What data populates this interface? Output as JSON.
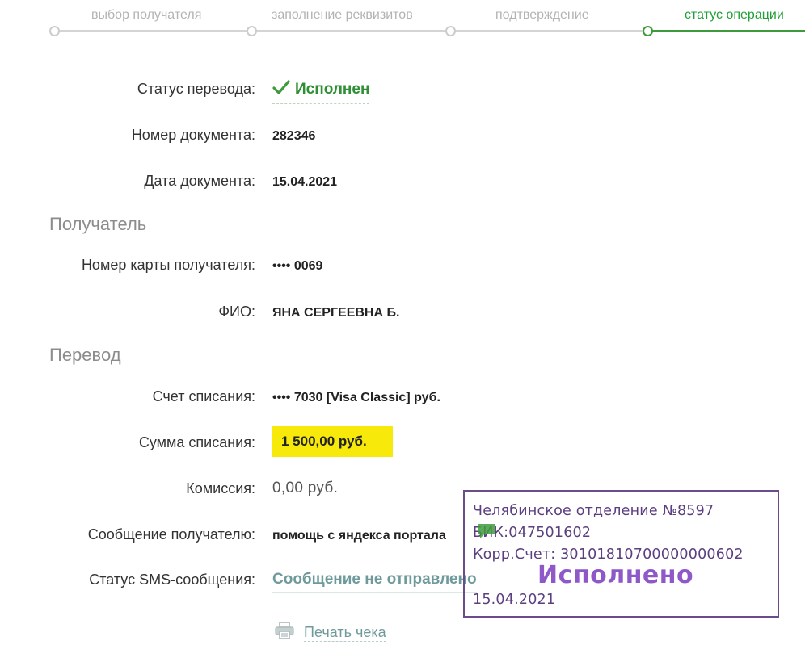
{
  "steps": [
    {
      "label": "выбор получателя",
      "active": false
    },
    {
      "label": "заполнение реквизитов",
      "active": false
    },
    {
      "label": "подтверждение",
      "active": false
    },
    {
      "label": "статус операции",
      "active": true
    }
  ],
  "details": {
    "status_label": "Статус перевода:",
    "status_value": "Исполнен",
    "doc_number_label": "Номер документа:",
    "doc_number_value": "282346",
    "doc_date_label": "Дата документа:",
    "doc_date_value": "15.04.2021"
  },
  "recipient": {
    "section_title": "Получатель",
    "card_label": "Номер карты получателя:",
    "card_value": "•••• 0069",
    "name_label": "ФИО:",
    "name_value": "ЯНА СЕРГЕЕВНА Б."
  },
  "transfer": {
    "section_title": "Перевод",
    "account_label": "Счет списания:",
    "account_value": "•••• 7030  [Visa Classic]  руб.",
    "amount_label": "Сумма списания:",
    "amount_value": "1 500,00  руб.",
    "fee_label": "Комиссия:",
    "fee_value": "0,00 руб.",
    "message_label": "Сообщение получателю:",
    "message_value": "помощь с яндекса портала",
    "sms_label": "Статус SMS-сообщения:",
    "sms_value": "Сообщение не отправлено"
  },
  "print": {
    "label": "Печать чека"
  },
  "stamp": {
    "branch": "Челябинское отделение №8597",
    "bik": "БИК:047501602",
    "corr": "Корр.Счет: 30101810700000000602",
    "status": "Исполнено",
    "date": "15.04.2021"
  },
  "colors": {
    "accent_green": "#21a038",
    "amount_highlight": "#f7ea0a",
    "stamp_purple": "#6a4c8a",
    "link_teal": "#6f9a9b"
  },
  "icons": {
    "status": "check-icon",
    "sms": "message-bubble-icon",
    "print": "printer-icon"
  }
}
